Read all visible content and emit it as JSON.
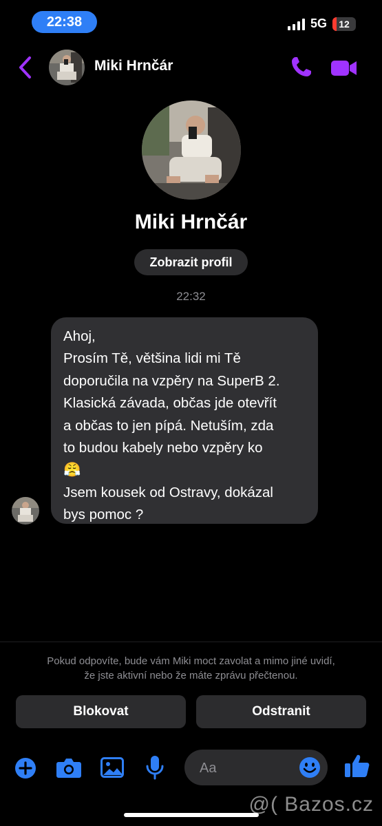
{
  "status": {
    "time": "22:38",
    "network": "5G",
    "battery": "12",
    "battery_level": 0.12
  },
  "header": {
    "name": "Miki Hrnčár"
  },
  "profile": {
    "name": "Miki Hrnčár",
    "view_profile_label": "Zobrazit profil"
  },
  "conversation": {
    "timestamp": "22:32",
    "message_lines": [
      "Ahoj,",
      "Prosím Tě, většina lidi mi Tě",
      "doporučila na vzpěry na SuperB 2.",
      "Klasická závada, občas jde otevřít",
      "a občas to jen pípá. Netuším, zda",
      "to budou kabely nebo vzpěry ko",
      "😤",
      "Jsem kousek od Ostravy, dokázal",
      "bys pomoc ?"
    ]
  },
  "notice": {
    "line1": "Pokud odpovíte, bude vám Miki moct zavolat a mimo jiné uvidí,",
    "line2": "že jste aktivní nebo že máte zprávu přečtenou."
  },
  "actions": {
    "block_label": "Blokovat",
    "remove_label": "Odstranit"
  },
  "composer": {
    "placeholder": "Aa"
  },
  "icons": {
    "back": "chevron-left-icon",
    "call": "phone-icon",
    "video": "video-camera-icon",
    "add": "plus-icon",
    "camera": "camera-icon",
    "gallery": "image-icon",
    "mic": "microphone-icon",
    "emoji": "emoji-icon",
    "like": "thumbs-up-icon"
  },
  "colors": {
    "accent": "#a033ff",
    "blue": "#2f7ff6",
    "bubble": "#303033"
  },
  "watermark": "@( Bazos.cz"
}
